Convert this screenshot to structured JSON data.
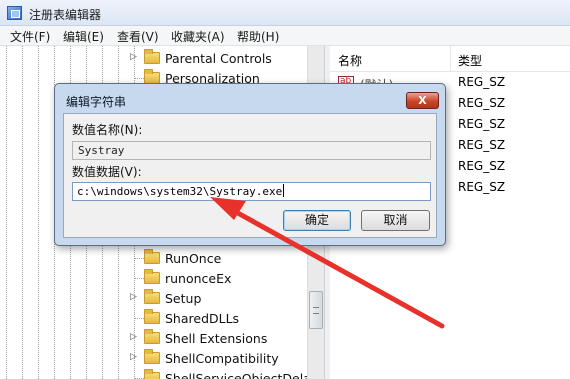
{
  "window": {
    "title": "注册表编辑器"
  },
  "menu": [
    "文件(F)",
    "编辑(E)",
    "查看(V)",
    "收藏夹(A)",
    "帮助(H)"
  ],
  "tree": {
    "items": [
      {
        "label": "Parental Controls",
        "expandable": true
      },
      {
        "label": "Personalization",
        "expandable": false
      },
      {
        "label": "RunOnce",
        "expandable": false
      },
      {
        "label": "runonceEx",
        "expandable": false
      },
      {
        "label": "Setup",
        "expandable": true
      },
      {
        "label": "SharedDLLs",
        "expandable": false
      },
      {
        "label": "Shell Extensions",
        "expandable": true
      },
      {
        "label": "ShellCompatibility",
        "expandable": true
      },
      {
        "label": "ShellServiceObjectDelayl",
        "expandable": false
      }
    ]
  },
  "list": {
    "columns": {
      "name": "名称",
      "type": "类型"
    },
    "rows": [
      {
        "name": "(默认)",
        "type": "REG_SZ"
      },
      {
        "name": "",
        "type": "REG_SZ"
      },
      {
        "name": "",
        "type": "REG_SZ"
      },
      {
        "name": "",
        "type": "REG_SZ"
      },
      {
        "name": "",
        "type": "REG_SZ"
      },
      {
        "name": "",
        "type": "REG_SZ"
      }
    ]
  },
  "dialog": {
    "title": "编辑字符串",
    "close_label": "X",
    "name_label": "数值名称(N):",
    "name_value": "Systray",
    "data_label": "数值数据(V):",
    "data_value": "c:\\windows\\system32\\Systray.exe",
    "ok_label": "确定",
    "cancel_label": "取消"
  },
  "colors": {
    "annotation_arrow": "#e8312a",
    "dialog_frame": "#c7d9ee"
  }
}
